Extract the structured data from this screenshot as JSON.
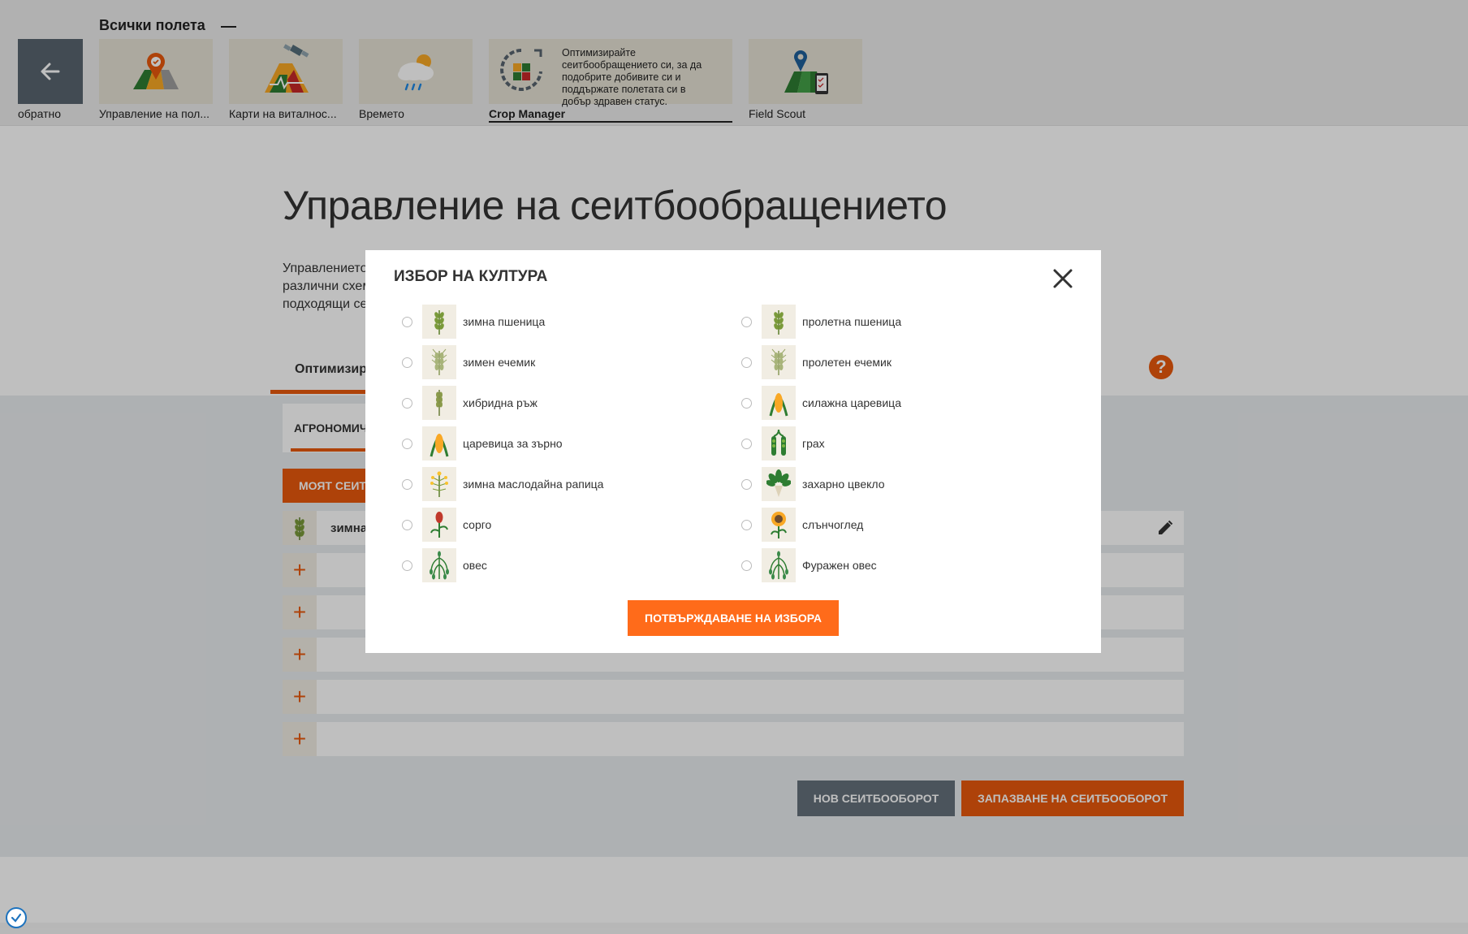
{
  "topnav": {
    "title": "Всички полета",
    "back_label": "обратно",
    "tiles": [
      {
        "label": "Управление на пол...",
        "icon": "field-map-pin-icon"
      },
      {
        "label": "Карти на виталнос...",
        "icon": "satellite-vitality-map-icon"
      },
      {
        "label": "Времето",
        "icon": "weather-cloud-icon"
      },
      {
        "label": "Crop Manager",
        "icon": "crop-rotation-icon"
      },
      {
        "label": "Field Scout",
        "icon": "field-scout-phone-icon"
      }
    ],
    "tooltip": "Оптимизирайте сеитбообращението си, за да подобрите добивите си и поддържате полетата си в добър здравен статус."
  },
  "page": {
    "title": "Управление на сеитбообращението",
    "intro_lines": [
      "Управлението",
      "различни схем",
      "подходящи се"
    ],
    "tab_label": "Оптимизир",
    "subtab_label": "АГРОНОМИЧ",
    "my_rotation_label": "МОЯТ СЕИТ",
    "rotation_first_crop": "зимна"
  },
  "actions": {
    "new_rotation": "НОВ СЕИТБООБОРОТ",
    "save_rotation": "ЗАПАЗВАНЕ НА СЕИТБООБОРОТ"
  },
  "modal": {
    "title": "ИЗБОР НА КУЛТУРА",
    "confirm": "ПОТВЪРЖДАВАНЕ НА ИЗБОРА",
    "left_options": [
      {
        "label": "зимна пшеница",
        "icon": "wheat-icon"
      },
      {
        "label": "зимен ечемик",
        "icon": "barley-icon"
      },
      {
        "label": "хибридна ръж",
        "icon": "rye-icon"
      },
      {
        "label": "царевица за зърно",
        "icon": "corn-icon"
      },
      {
        "label": "зимна маслодайна рапица",
        "icon": "rapeseed-icon"
      },
      {
        "label": "сорго",
        "icon": "sorghum-icon"
      },
      {
        "label": "овес",
        "icon": "oat-icon"
      }
    ],
    "right_options": [
      {
        "label": "пролетна пшеница",
        "icon": "wheat-icon"
      },
      {
        "label": "пролетен ечемик",
        "icon": "barley-icon"
      },
      {
        "label": "силажна царевица",
        "icon": "corn-icon"
      },
      {
        "label": "грах",
        "icon": "pea-icon"
      },
      {
        "label": "захарно цвекло",
        "icon": "sugar-beet-icon"
      },
      {
        "label": "слънчоглед",
        "icon": "sunflower-icon"
      },
      {
        "label": "Фуражен овес",
        "icon": "oat-icon"
      }
    ]
  },
  "colors": {
    "accent": "#e8590c",
    "confirm": "#ff6b1a",
    "secondary_button": "#64707b",
    "icon_background": "#f1ede3"
  }
}
